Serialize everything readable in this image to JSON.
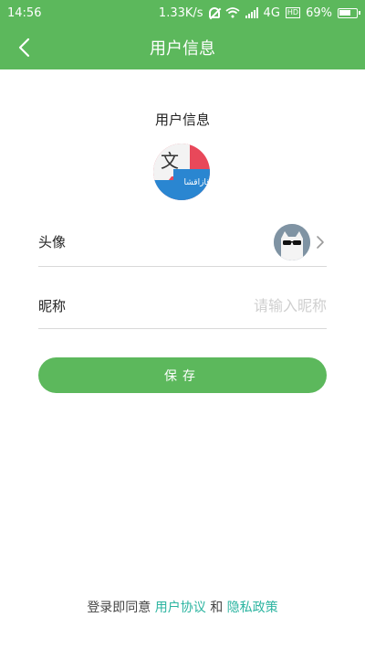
{
  "status_bar": {
    "time": "14:56",
    "net_speed": "1.33K/s",
    "network": "4G",
    "hd_badge": "HD",
    "battery": "69%"
  },
  "navbar": {
    "title": "用户信息",
    "back_icon": "chevron-left-icon"
  },
  "profile": {
    "section_title": "用户信息",
    "logo_char": "文",
    "logo_script": "قازاقشا"
  },
  "rows": {
    "avatar_label": "头像",
    "nickname_label": "昵称",
    "nickname_placeholder": "请输入昵称",
    "nickname_value": ""
  },
  "save_label": "保存",
  "agreement": {
    "prefix": "登录即同意",
    "user_agreement": "用户协议",
    "and": "和",
    "privacy_policy": "隐私政策"
  },
  "colors": {
    "primary": "#5cb85c",
    "link": "#2bb4a0"
  }
}
